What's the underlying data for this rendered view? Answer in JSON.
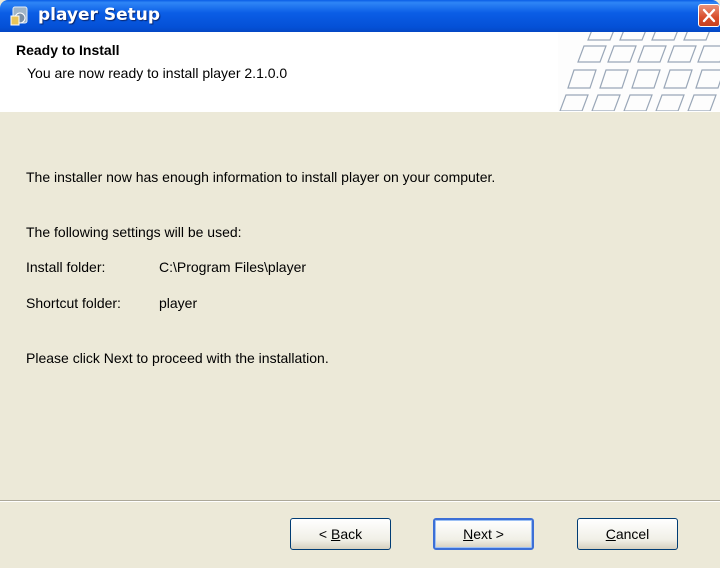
{
  "window": {
    "title": "player Setup"
  },
  "header": {
    "title": "Ready to Install",
    "subtitle": "You are now ready to install player 2.1.0.0"
  },
  "content": {
    "intro": "The installer now has enough information to install player on your computer.",
    "settings_heading": "The following settings will be used:",
    "install_folder_label": "Install folder:",
    "install_folder_value": "C:\\Program Files\\player",
    "shortcut_folder_label": "Shortcut folder:",
    "shortcut_folder_value": "player",
    "proceed_text": "Please click Next to proceed with the installation."
  },
  "buttons": {
    "back": {
      "prefix": "< ",
      "accel": "B",
      "rest": "ack"
    },
    "next": {
      "accel": "N",
      "rest": "ext >"
    },
    "cancel": {
      "accel": "C",
      "rest": "ancel"
    }
  },
  "colors": {
    "titlebar": "#0450d6",
    "dialog_bg": "#ece9d8",
    "close": "#d84d2a"
  }
}
